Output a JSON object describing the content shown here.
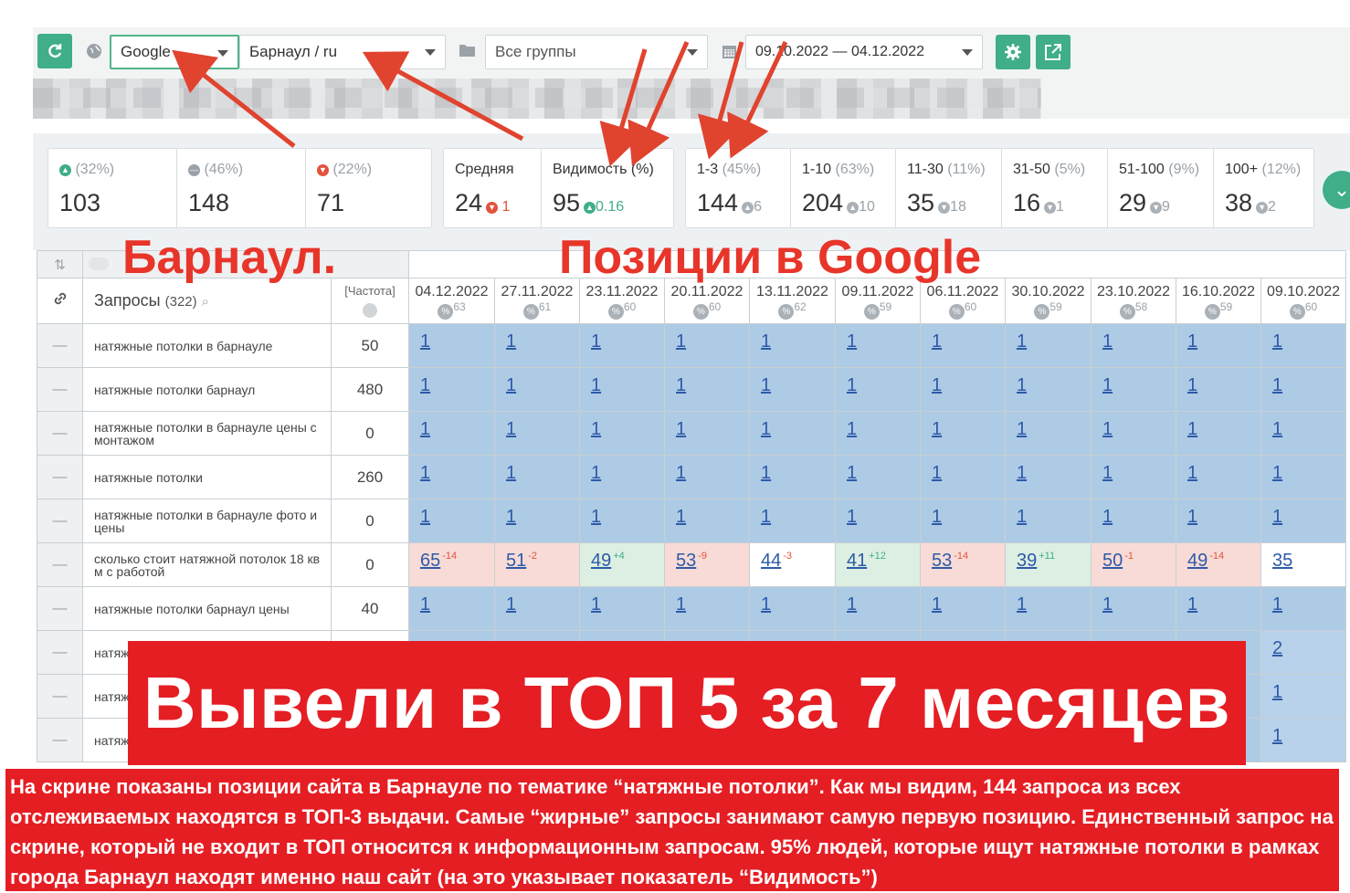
{
  "toolbar": {
    "engine": "Google",
    "region": "Барнаул / ru",
    "groups": "Все группы",
    "daterange": "09.10.2022 — 04.12.2022"
  },
  "summary": {
    "trend": [
      {
        "icon": "arrow-up-icon",
        "pct": "(32%)",
        "value": "103"
      },
      {
        "icon": "minus-icon",
        "pct": "(46%)",
        "value": "148"
      },
      {
        "icon": "arrow-down-icon",
        "pct": "(22%)",
        "value": "71"
      }
    ],
    "avg": {
      "label": "Средняя",
      "value": "24",
      "delta": "1"
    },
    "visibility": {
      "label": "Видимость (%)",
      "value": "95",
      "delta": "0.16"
    },
    "ranges": [
      {
        "label": "1-3",
        "pct": "(45%)",
        "value": "144",
        "delta": "6"
      },
      {
        "label": "1-10",
        "pct": "(63%)",
        "value": "204",
        "delta": "10"
      },
      {
        "label": "11-30",
        "pct": "(11%)",
        "value": "35",
        "delta": "18"
      },
      {
        "label": "31-50",
        "pct": "(5%)",
        "value": "16",
        "delta": "1"
      },
      {
        "label": "51-100",
        "pct": "(9%)",
        "value": "29",
        "delta": "9"
      },
      {
        "label": "100+",
        "pct": "(12%)",
        "value": "38",
        "delta": "2"
      }
    ]
  },
  "table": {
    "queries_label": "Запросы",
    "queries_count": "(322)",
    "freq_label": "[Частота]",
    "dates": [
      {
        "date": "04.12.2022",
        "vis": "63"
      },
      {
        "date": "27.11.2022",
        "vis": "61"
      },
      {
        "date": "23.11.2022",
        "vis": "60"
      },
      {
        "date": "20.11.2022",
        "vis": "60"
      },
      {
        "date": "13.11.2022",
        "vis": "62"
      },
      {
        "date": "09.11.2022",
        "vis": "59"
      },
      {
        "date": "06.11.2022",
        "vis": "60"
      },
      {
        "date": "30.10.2022",
        "vis": "59"
      },
      {
        "date": "23.10.2022",
        "vis": "58"
      },
      {
        "date": "16.10.2022",
        "vis": "59"
      },
      {
        "date": "09.10.2022",
        "vis": "60"
      }
    ],
    "rows": [
      {
        "q": "натяжные потолки в барнауле",
        "f": "50",
        "p": [
          "1",
          "1",
          "1",
          "1",
          "1",
          "1",
          "1",
          "1",
          "1",
          "1",
          "1"
        ]
      },
      {
        "q": "натяжные потолки барнаул",
        "f": "480",
        "p": [
          "1",
          "1",
          "1",
          "1",
          "1",
          "1",
          "1",
          "1",
          "1",
          "1",
          "1"
        ]
      },
      {
        "q": "натяжные потолки в барнауле цены с монтажом",
        "f": "0",
        "p": [
          "1",
          "1",
          "1",
          "1",
          "1",
          "1",
          "1",
          "1",
          "1",
          "1",
          "1"
        ]
      },
      {
        "q": "натяжные потолки",
        "f": "260",
        "p": [
          "1",
          "1",
          "1",
          "1",
          "1",
          "1",
          "1",
          "1",
          "1",
          "1",
          "1"
        ]
      },
      {
        "q": "натяжные потолки в барнауле фото и цены",
        "f": "0",
        "p": [
          "1",
          "1",
          "1",
          "1",
          "1",
          "1",
          "1",
          "1",
          "1",
          "1",
          "1"
        ]
      },
      {
        "q": "сколько стоит натяжной потолок 18 кв м с работой",
        "f": "0",
        "p": [
          "65",
          "51",
          "49",
          "53",
          "44",
          "41",
          "53",
          "39",
          "50",
          "49",
          "35"
        ],
        "d": [
          "-14",
          "-2",
          "+4",
          "-9",
          "-3",
          "+12",
          "-14",
          "+11",
          "-1",
          "-14",
          ""
        ]
      },
      {
        "q": "натяжные потолки барнаул цены",
        "f": "40",
        "p": [
          "1",
          "1",
          "1",
          "1",
          "1",
          "1",
          "1",
          "1",
          "1",
          "1",
          "1"
        ]
      },
      {
        "q": "натяж",
        "f": "",
        "p": [
          "",
          "",
          "",
          "",
          "",
          "",
          "",
          "",
          "",
          "",
          "2"
        ]
      },
      {
        "q": "натяж цены",
        "f": "",
        "p": [
          "",
          "",
          "",
          "",
          "",
          "",
          "",
          "",
          "",
          "",
          "1"
        ]
      },
      {
        "q": "натяж недор",
        "f": "",
        "p": [
          "",
          "",
          "",
          "",
          "",
          "",
          "",
          "",
          "",
          "",
          "1"
        ]
      }
    ]
  },
  "annotations": {
    "city": "Барнаул.",
    "google": "Позиции в Google",
    "banner": "Вывели в ТОП 5 за 7 месяцев",
    "note": "На скрине показаны позиции сайта в Барнауле по тематике “натяжные потолки”. Как мы видим, 144 запроса из всех отслеживаемых находятся в ТОП-3 выдачи. Самые “жирные” запросы занимают самую первую позицию. Единственный запрос на скрине, который не входит в ТОП относится к информационным запросам. 95% людей, которые ищут натяжные потолки в рамках города Барнаул находят именно наш сайт (на это указывает показатель “Видимость”)"
  },
  "colors": {
    "accent": "#3fae89",
    "annotation_red": "#e51e24",
    "cell_blue": "#aecbe6"
  }
}
